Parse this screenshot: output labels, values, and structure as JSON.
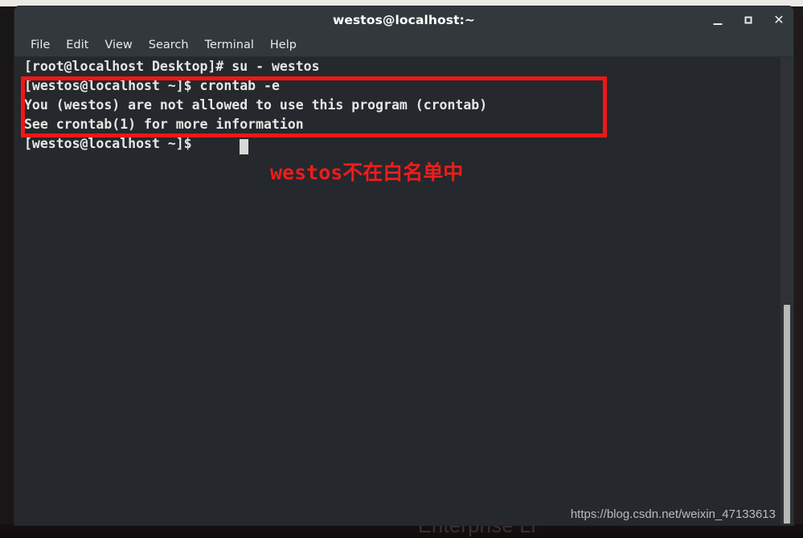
{
  "window": {
    "title": "westos@localhost:~",
    "controls": {
      "minimize_label": "_",
      "maximize_label": "□",
      "close_label": "✕"
    }
  },
  "menubar": {
    "items": [
      {
        "label": "File"
      },
      {
        "label": "Edit"
      },
      {
        "label": "View"
      },
      {
        "label": "Search"
      },
      {
        "label": "Terminal"
      },
      {
        "label": "Help"
      }
    ]
  },
  "terminal": {
    "lines": [
      {
        "text": "[root@localhost Desktop]# su - westos"
      },
      {
        "text": "[westos@localhost ~]$ crontab -e"
      },
      {
        "text": "You (westos) are not allowed to use this program (crontab)"
      },
      {
        "text": "See crontab(1) for more information"
      },
      {
        "text": "[westos@localhost ~]$"
      }
    ],
    "annotation_note": "westos不在白名单中",
    "watermark": "https://blog.csdn.net/weixin_47133613",
    "desktop_text": "Enterprise Li",
    "colors": {
      "background": "#25282c",
      "foreground": "#e6e6e6",
      "annotation": "#f01717",
      "titlebar": "#32383b"
    }
  }
}
